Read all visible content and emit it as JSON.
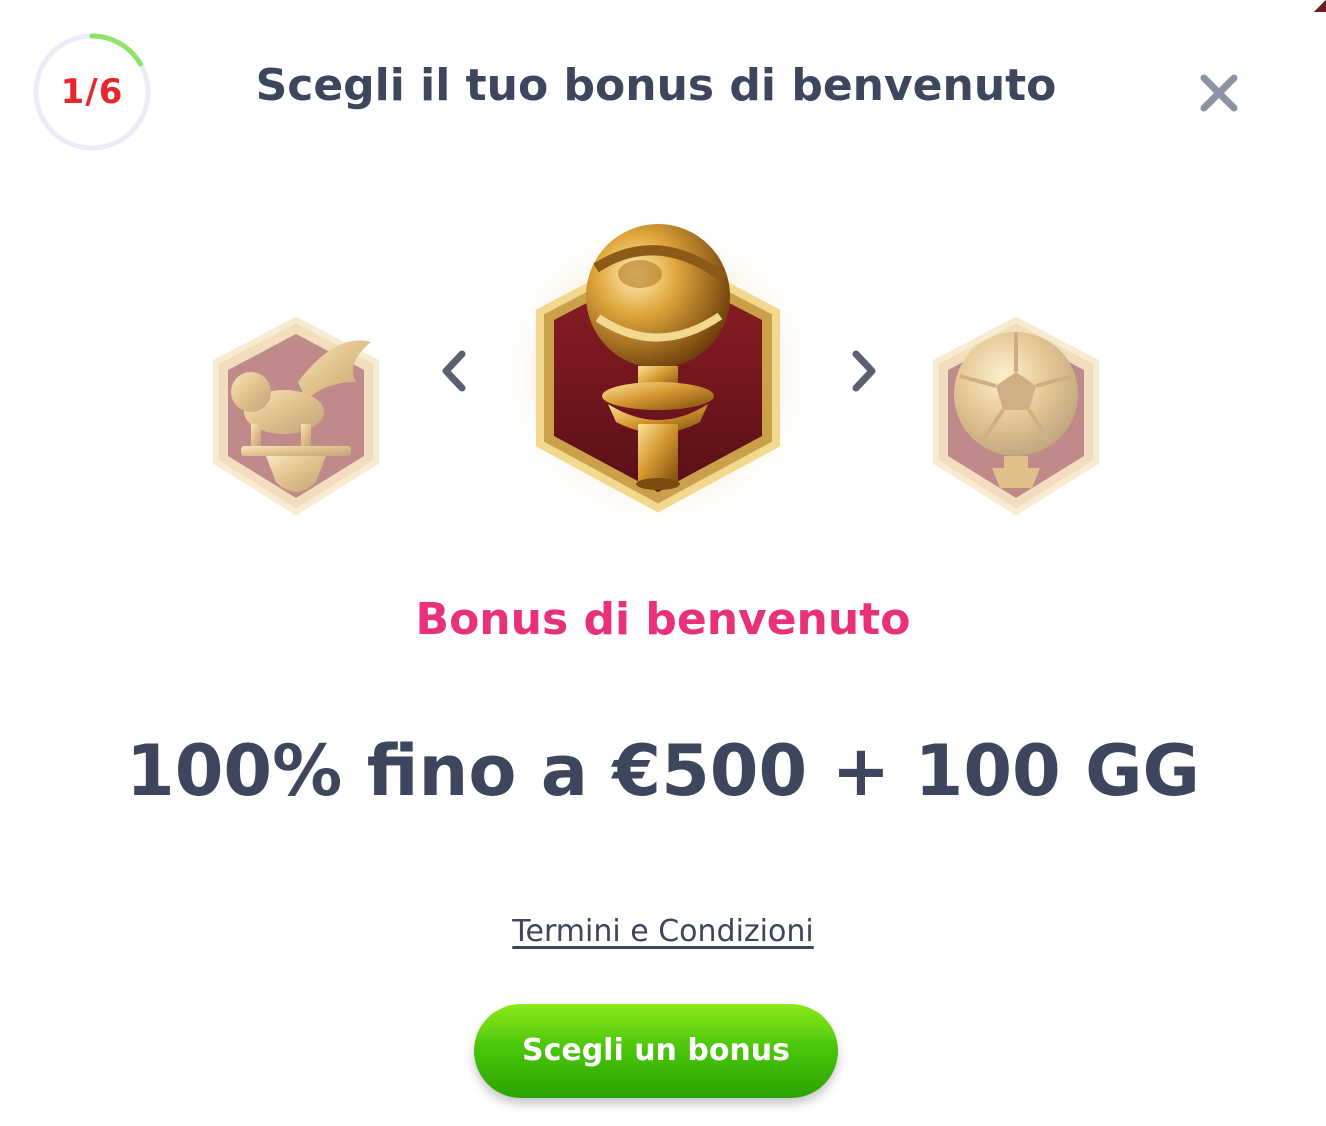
{
  "header": {
    "step_label": "1/6",
    "step_current": 1,
    "step_total": 6,
    "title": "Scegli il tuo bonus di benvenuto",
    "close_icon": "close-icon"
  },
  "carousel": {
    "prev_icon": "chevron-left-icon",
    "next_icon": "chevron-right-icon",
    "items": [
      {
        "icon": "winged-lion-trophy-icon",
        "state": "previous"
      },
      {
        "icon": "globe-trophy-icon",
        "state": "selected"
      },
      {
        "icon": "golden-ball-trophy-icon",
        "state": "next"
      }
    ]
  },
  "bonus": {
    "name": "Bonus di benvenuto",
    "offer": "100% fino a €500 + 100 GG"
  },
  "footer": {
    "terms_link": "Termini e Condizioni",
    "cta_label": "Scegli un bonus"
  },
  "colors": {
    "title": "#3d465d",
    "step_text": "#e8262d",
    "progress_ring": "#8fe36a",
    "ring_track": "#ececf8",
    "bonus_name": "#e8317a",
    "cta_green": "#4cc70b",
    "badge_red": "#7a1a22",
    "badge_gold": "#d9a441"
  }
}
